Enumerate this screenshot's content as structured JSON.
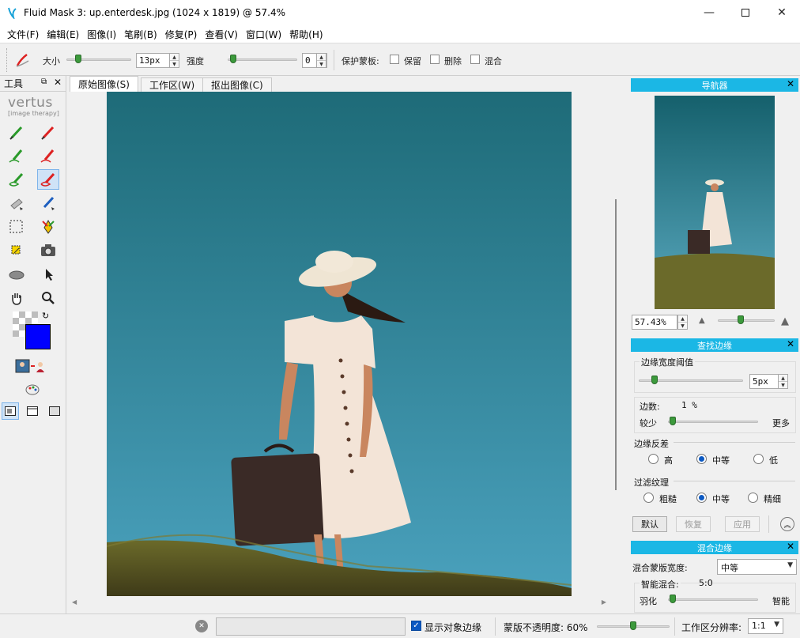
{
  "window": {
    "title": "Fluid Mask 3: up.enterdesk.jpg (1024 x 1819) @ 57.4%"
  },
  "menu": [
    "文件(F)",
    "编辑(E)",
    "图像(I)",
    "笔刷(B)",
    "修复(P)",
    "查看(V)",
    "窗口(W)",
    "帮助(H)"
  ],
  "toolbar": {
    "size_label": "大小",
    "size_value": "13px",
    "strength_label": "强度",
    "strength_value": "0",
    "protect_label": "保护蒙板:",
    "keep_label": "保留",
    "delete_label": "删除",
    "blend_label": "混合",
    "size_slider_level": 0.2,
    "strength_slider_level": 0.0
  },
  "tools_panel": {
    "title": "工具",
    "logo": "vertus",
    "logo_sub": "[image therapy]"
  },
  "tabs": [
    {
      "label": "原始图像(S)",
      "active": true
    },
    {
      "label": "工作区(W)",
      "active": false
    },
    {
      "label": "抠出图像(C)",
      "active": false
    }
  ],
  "navigator": {
    "title": "导航器",
    "zoom_value": "57.43%"
  },
  "find_edge": {
    "title": "查找边缘",
    "threshold_label": "边缘宽度阈值",
    "threshold_value": "5px",
    "edge_count_label": "边数:",
    "edge_count_value": "1 %",
    "less_label": "较少",
    "more_label": "更多",
    "contrast_label": "边缘反差",
    "contrast_options": [
      "高",
      "中等",
      "低"
    ],
    "contrast_selected": "中等",
    "texture_label": "过滤纹理",
    "texture_options": [
      "粗糙",
      "中等",
      "精细"
    ],
    "texture_selected": "中等",
    "default_button": "默认",
    "restore_button": "恢复",
    "apply_button": "应用"
  },
  "blend_edge": {
    "title": "混合边缘",
    "width_label": "混合蒙版宽度:",
    "width_value": "中等",
    "smart_label": "智能混合:",
    "smart_value": "5:0",
    "feather_label": "羽化",
    "smart_end_label": "智能"
  },
  "status": {
    "show_edges_label": "显示对象边缘",
    "opacity_label": "蒙版不透明度: 60%",
    "opacity_level": 0.6,
    "resolution_label": "工作区分辨率:",
    "resolution_value": "1:1"
  },
  "colors": {
    "accent": "#1bb7e5",
    "sky_top": "#1e6b78",
    "sky_bottom": "#4aa1bd",
    "swatch": "#0000ff"
  }
}
